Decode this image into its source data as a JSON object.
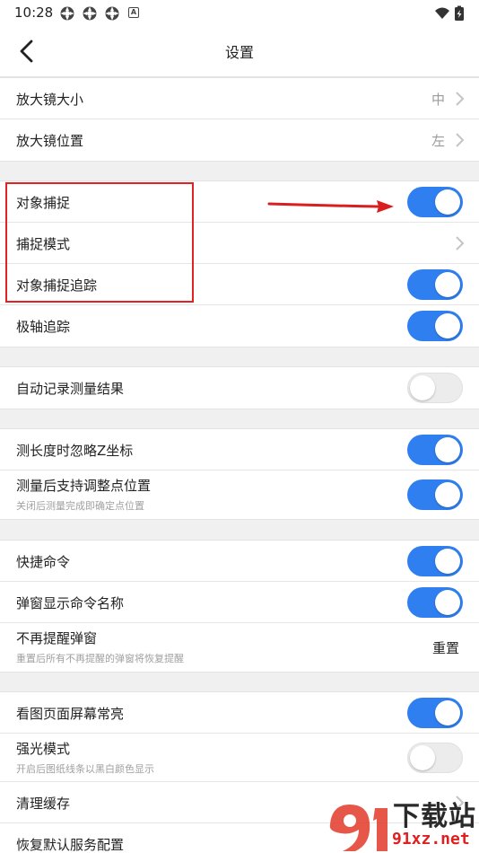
{
  "status_bar": {
    "time": "10:28",
    "notif_box_letter": "A"
  },
  "header": {
    "title": "设置"
  },
  "groups": [
    {
      "rows": [
        {
          "label": "放大镜大小",
          "value": "中"
        },
        {
          "label": "放大镜位置",
          "value": "左"
        }
      ]
    },
    {
      "rows": [
        {
          "label": "对象捕捉",
          "toggle": true
        },
        {
          "label": "捕捉模式"
        },
        {
          "label": "对象捕捉追踪",
          "toggle": true
        },
        {
          "label": "极轴追踪",
          "toggle": true
        }
      ]
    },
    {
      "rows": [
        {
          "label": "自动记录测量结果",
          "toggle": false
        }
      ]
    },
    {
      "rows": [
        {
          "label": "测长度时忽略Z坐标",
          "toggle": true
        },
        {
          "label": "测量后支持调整点位置",
          "sub": "关闭后测量完成即确定点位置",
          "toggle": true
        }
      ]
    },
    {
      "rows": [
        {
          "label": "快捷命令",
          "toggle": true
        },
        {
          "label": "弹窗显示命令名称",
          "toggle": true
        },
        {
          "label": "不再提醒弹窗",
          "sub": "重置后所有不再提醒的弹窗将恢复提醒",
          "action": "重置"
        }
      ]
    },
    {
      "rows": [
        {
          "label": "看图页面屏幕常亮",
          "toggle": true
        },
        {
          "label": "强光模式",
          "sub": "开启后图纸线条以黑白颜色显示",
          "toggle": false
        },
        {
          "label": "清理缓存"
        },
        {
          "label": "恢复默认服务配置"
        }
      ]
    }
  ],
  "watermark": {
    "text_top": "下载站",
    "text_bottom": "91xz.net"
  },
  "colors": {
    "accent": "#2f7ff0",
    "highlight": "#e02222",
    "background": "#f0f0f0"
  }
}
